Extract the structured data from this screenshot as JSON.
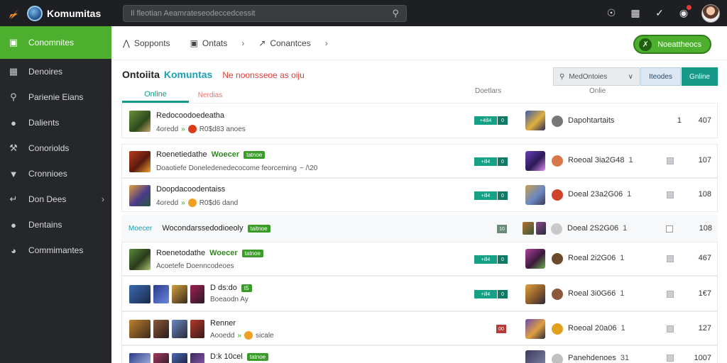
{
  "app": {
    "name": "Komumitas"
  },
  "search": {
    "placeholder": "Il fleotian Aeamrateseodeccedcessit"
  },
  "sidebar": {
    "items": [
      {
        "label": "Conomnites",
        "icon": "card-icon",
        "active": true
      },
      {
        "label": "Denoires",
        "icon": "grid-icon"
      },
      {
        "label": "Parienie Eians",
        "icon": "search-icon"
      },
      {
        "label": "Dalients",
        "icon": "users-icon"
      },
      {
        "label": "Conoriolds",
        "icon": "wrench-icon"
      },
      {
        "label": "Cronnioes",
        "icon": "inbox-icon"
      },
      {
        "label": "Don Dees",
        "icon": "share-icon",
        "has_chevron": true
      },
      {
        "label": "Dentains",
        "icon": "chat-icon"
      },
      {
        "label": "Commimantes",
        "icon": "history-icon"
      }
    ]
  },
  "breadcrumb": {
    "first": "Sopponts",
    "second": "Ontats",
    "third": "Conantces"
  },
  "cta": {
    "label": "Noeattheocs",
    "icon_text": "✗"
  },
  "heading": {
    "part1": "Ontoiita",
    "part2": "Komuntas",
    "part3": "Ne noonsseoe as oiju"
  },
  "filter": {
    "label": "MedOntoies"
  },
  "segment": {
    "one": "Iteodes",
    "two": "Gnline"
  },
  "tabs": {
    "online": "Online",
    "pending": "Nerdias"
  },
  "columns": {
    "c1": "Doetlars",
    "c2": "Onlie"
  },
  "rows": [
    {
      "title": "Redocoodoedeatha",
      "sub": "4oredd",
      "sub2": "R0$d83 anoes",
      "badge1": "+4ill4",
      "badge2": "0",
      "right": "Dapohtartaits",
      "bookmark": "",
      "count": "407",
      "check": "1"
    },
    {
      "title": "Roenetiedathe",
      "green": "Woecer",
      "tag": "tatnoe",
      "sub": "Doaotiefe Doneledenedecocome feorceming",
      "sub2": "~ /\\20",
      "badge1": "+ill4",
      "badge2": "0",
      "right": "Roeoal 3ia2G48",
      "bookmark": "1",
      "count": "107"
    },
    {
      "title": "Doopdacoodentaiss",
      "sub": "4oredd",
      "sub2": "R0$d6 dand",
      "badge1": "+ill4",
      "badge2": "0",
      "right": "Doeal 23a2G06",
      "bookmark": "1",
      "count": "108"
    },
    {
      "section": "Moecer",
      "title": "Wocondarssedodioeoly",
      "tag": "taitnoe",
      "badge2": "10",
      "right": "Doeal 2S2G06",
      "bookmark": "1",
      "count": "108"
    },
    {
      "title": "Roenetodathe",
      "green": "Woecer",
      "tag": "tatnoe",
      "sub": "Acoetefe Doenncodeoes",
      "badge1": "+ill4",
      "badge2": "0",
      "right": "Roeal 2i2G06",
      "bookmark": "1",
      "count": "467"
    },
    {
      "title": "D ds:do",
      "tag": "t5",
      "sub": "Boeaodn Ay",
      "badge1": "+ill4",
      "badge2": "0",
      "right": "Roeal 3i0G66",
      "bookmark": "1",
      "count": "1€7"
    },
    {
      "title": "Renner",
      "sub": "Aooedd",
      "sub2": "sicale",
      "badge2": "00",
      "right": "Roeoal 20a06",
      "bookmark": "1",
      "count": "127"
    },
    {
      "title": "D:k 10cel",
      "tag": "tatnoe",
      "right": "Panehdenoes",
      "bookmark": "31",
      "count": "1007"
    }
  ],
  "colors": {
    "sidebar_active": "#4caf2e",
    "accent_teal": "#169988",
    "topbar": "#1e1f22",
    "sidebar": "#25272b"
  }
}
